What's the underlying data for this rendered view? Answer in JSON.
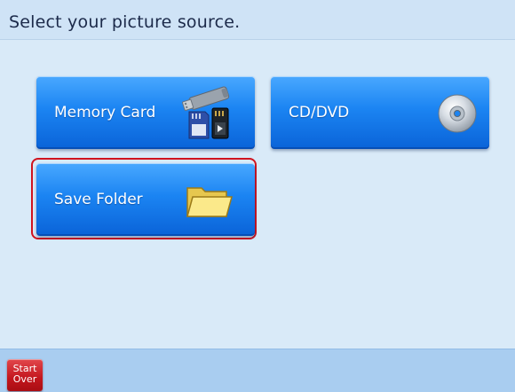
{
  "header": {
    "title": "Select your picture source."
  },
  "sources": [
    {
      "label": "Memory Card",
      "icon": "memory-card-icon"
    },
    {
      "label": "CD/DVD",
      "icon": "disc-icon"
    },
    {
      "label": "Save Folder",
      "icon": "folder-icon",
      "selected": true
    }
  ],
  "footer": {
    "start_over_line1": "Start",
    "start_over_line2": "Over"
  },
  "colors": {
    "button_blue": "#1b84f2",
    "background": "#d9eaf8",
    "footer": "#a9cdf0",
    "selection_ring": "#d0141f",
    "start_over_red": "#c3161d"
  }
}
